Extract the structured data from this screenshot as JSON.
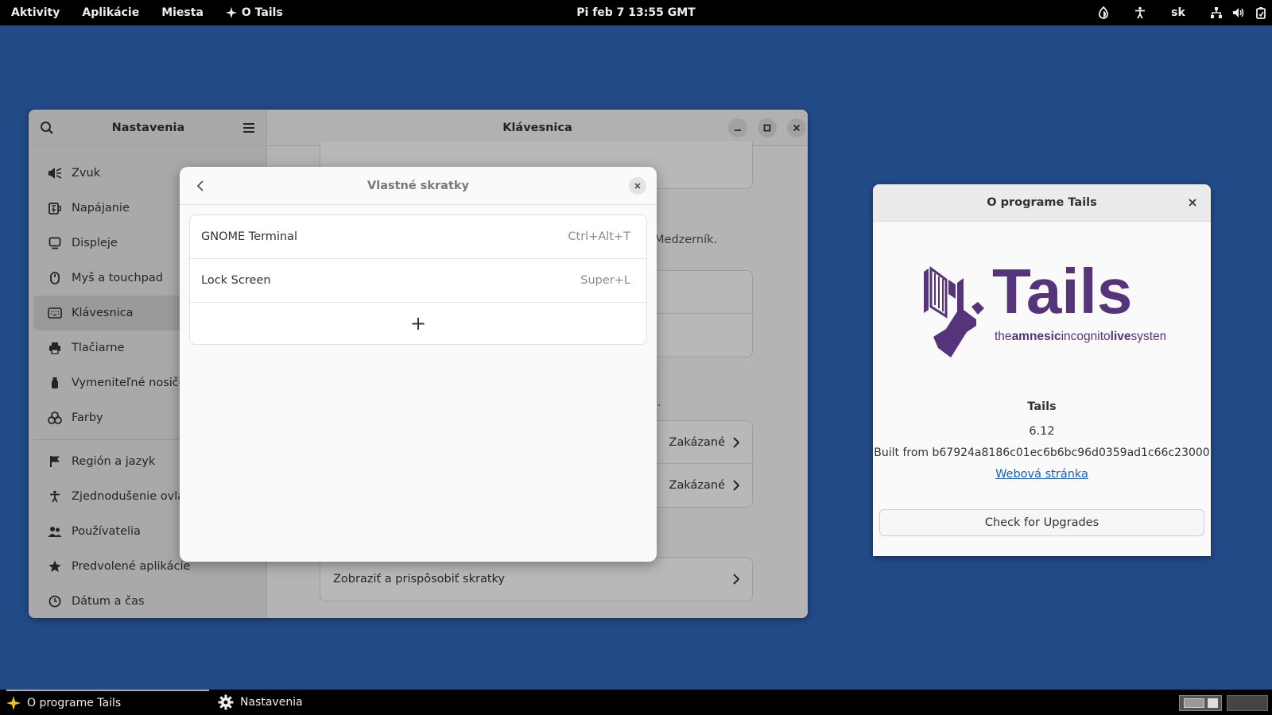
{
  "topbar": {
    "activities": "Aktivity",
    "applications": "Aplikácie",
    "places": "Miesta",
    "about_app": "O Tails",
    "clock": "Pi feb 7  13:55 GMT",
    "language": "sk"
  },
  "settings": {
    "sidebar_title": "Nastavenia",
    "page_title": "Klávesnica",
    "sidebar_items": [
      {
        "label": "Zvuk",
        "icon": "speaker-icon"
      },
      {
        "label": "Napájanie",
        "icon": "battery-icon"
      },
      {
        "label": "Displeje",
        "icon": "display-icon"
      },
      {
        "label": "Myš a touchpad",
        "icon": "mouse-icon"
      },
      {
        "label": "Klávesnica",
        "icon": "keyboard-icon"
      },
      {
        "label": "Tlačiarne",
        "icon": "printer-icon"
      },
      {
        "label": "Vymeniteľné nosiče",
        "icon": "usb-icon"
      },
      {
        "label": "Farby",
        "icon": "colors-icon"
      },
      {
        "label": "Región a jazyk",
        "icon": "flag-icon"
      },
      {
        "label": "Zjednodušenie ovládania",
        "icon": "accessibility-icon"
      },
      {
        "label": "Používatelia",
        "icon": "users-icon"
      },
      {
        "label": "Predvolené aplikácie",
        "icon": "star-icon"
      },
      {
        "label": "Dátum a čas",
        "icon": "clock-icon"
      }
    ],
    "main": {
      "hint1": "er+Medzerník.",
      "hint2": "ice.",
      "disabled_1": "Zakázané",
      "disabled_2": "Zakázané",
      "view_shortcuts": "Zobraziť a prispôsobiť skratky"
    }
  },
  "dialog": {
    "title": "Vlastné skratky",
    "shortcuts": [
      {
        "name": "GNOME Terminal",
        "accel": "Ctrl+Alt+T"
      },
      {
        "name": "Lock Screen",
        "accel": "Super+L"
      }
    ],
    "add_symbol": "+"
  },
  "about": {
    "window_title": "O programe Tails",
    "logo_word": "Tails",
    "logo_tagline_1": "the",
    "logo_tagline_2": "amnesic",
    "logo_tagline_3": "incognito",
    "logo_tagline_4": "live",
    "logo_tagline_5": "system",
    "app_name": "Tails",
    "version": "6.12",
    "built_from": "Built from b67924a8186c01ec6b6bc96d0359ad1c66c23000",
    "website": "Webová stránka",
    "upgrade_button": "Check for Upgrades"
  },
  "taskbar": {
    "task_1": "O programe Tails",
    "task_2": "Nastavenia"
  },
  "colors": {
    "desktop": "#224a86",
    "tails_purple": "#56347c",
    "link": "#1a5fb4"
  }
}
